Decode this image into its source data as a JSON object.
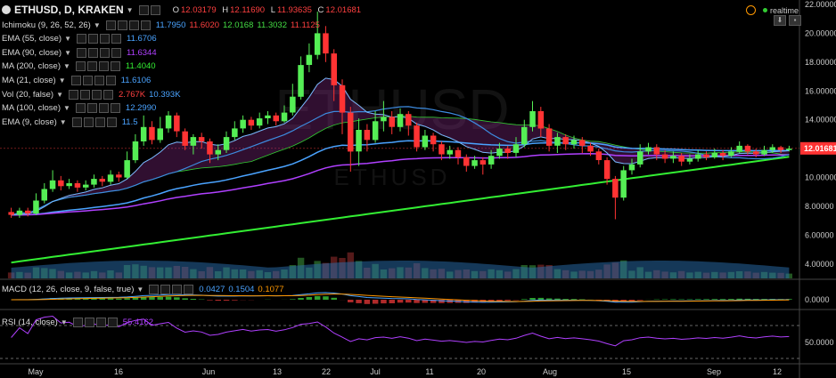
{
  "header": {
    "symbol_title": "ETHUSD, D, KRAKEN",
    "ohlc": [
      {
        "k": "O",
        "v": "12.03179"
      },
      {
        "k": "H",
        "v": "12.11690"
      },
      {
        "k": "L",
        "v": "11.93635"
      },
      {
        "k": "C",
        "v": "12.01681"
      }
    ],
    "realtime_label": "realtime"
  },
  "indicators": [
    {
      "name": "Ichimoku (9, 26, 52, 26)",
      "values": [
        {
          "text": "11.7950",
          "color": "#4aa3ff"
        },
        {
          "text": "11.6020",
          "color": "#ff4040"
        },
        {
          "text": "12.0168",
          "color": "#44dd44"
        },
        {
          "text": "11.3032",
          "color": "#44dd44"
        },
        {
          "text": "11.1125",
          "color": "#ff4040"
        }
      ]
    },
    {
      "name": "EMA (55, close)",
      "values": [
        {
          "text": "11.6706",
          "color": "#4aa3ff"
        }
      ]
    },
    {
      "name": "EMA (90, close)",
      "values": [
        {
          "text": "11.6344",
          "color": "#b040ff"
        }
      ]
    },
    {
      "name": "MA (200, close)",
      "values": [
        {
          "text": "11.4040",
          "color": "#33ee33"
        }
      ]
    },
    {
      "name": "MA (21, close)",
      "values": [
        {
          "text": "11.6106",
          "color": "#4aa3ff"
        }
      ]
    },
    {
      "name": "Vol (20, false)",
      "values": [
        {
          "text": "2.767K",
          "color": "#ff4040"
        },
        {
          "text": "10.393K",
          "color": "#4aa3ff"
        }
      ]
    },
    {
      "name": "MA (100, close)",
      "values": [
        {
          "text": "12.2990",
          "color": "#4aa3ff"
        }
      ]
    },
    {
      "name": "EMA (9, close)",
      "values": [
        {
          "text": "11.5",
          "color": "#4aa3ff"
        }
      ]
    }
  ],
  "watermark": {
    "big": "ETHUSD",
    "small": "ETHUSD"
  },
  "price_axis": {
    "ticks": [
      "22.00000",
      "20.00000",
      "18.00000",
      "16.00000",
      "14.00000",
      "12.00000",
      "10.00000",
      "8.00000",
      "6.00000",
      "4.00000"
    ],
    "last_price": "12.01681"
  },
  "macd": {
    "label": "MACD (12, 26, close, 9, false, true)",
    "values": [
      {
        "text": "0.0427",
        "color": "#4aa3ff"
      },
      {
        "text": "0.1504",
        "color": "#4aa3ff"
      },
      {
        "text": "0.1077",
        "color": "#ff9800"
      }
    ],
    "axis": [
      "0.0000"
    ]
  },
  "rsi": {
    "label": "RSI (14, close)",
    "value": {
      "text": "55.4162",
      "color": "#b040ff"
    },
    "axis": [
      "50.0000"
    ]
  },
  "time_axis": [
    "May",
    "16",
    "Jun",
    "13",
    "22",
    "Jul",
    "11",
    "20",
    "Aug",
    "15",
    "Sep",
    "12"
  ],
  "chart_data": {
    "type": "candlestick",
    "ylim": [
      3,
      22
    ],
    "y_ticks": [
      4,
      6,
      8,
      10,
      12,
      14,
      16,
      18,
      20,
      22
    ],
    "candles": [
      [
        7.6,
        7.4,
        7.9,
        7.2
      ],
      [
        7.4,
        7.7,
        7.9,
        7.2
      ],
      [
        7.7,
        7.5,
        7.9,
        7.3
      ],
      [
        7.5,
        8.4,
        8.9,
        7.4
      ],
      [
        8.4,
        9.2,
        9.6,
        8.2
      ],
      [
        9.2,
        9.8,
        10.5,
        9.0
      ],
      [
        9.8,
        9.4,
        10.1,
        9.1
      ],
      [
        9.4,
        9.6,
        9.9,
        9.2
      ],
      [
        9.6,
        9.3,
        9.8,
        9.0
      ],
      [
        9.3,
        9.5,
        9.8,
        9.1
      ],
      [
        9.5,
        9.9,
        10.2,
        9.3
      ],
      [
        9.9,
        9.7,
        10.1,
        9.4
      ],
      [
        9.7,
        10.2,
        10.5,
        9.5
      ],
      [
        10.2,
        10.0,
        10.4,
        9.7
      ],
      [
        10.0,
        11.2,
        11.8,
        9.9
      ],
      [
        11.2,
        12.5,
        13.0,
        11.0
      ],
      [
        12.5,
        13.5,
        14.3,
        12.2
      ],
      [
        13.5,
        12.6,
        13.9,
        12.3
      ],
      [
        12.6,
        13.4,
        14.2,
        12.4
      ],
      [
        13.4,
        14.3,
        14.6,
        13.1
      ],
      [
        14.3,
        13.2,
        14.5,
        12.8
      ],
      [
        13.2,
        12.2,
        13.4,
        11.9
      ],
      [
        12.2,
        12.8,
        13.0,
        11.6
      ],
      [
        12.8,
        12.5,
        13.1,
        12.0
      ],
      [
        12.5,
        11.6,
        12.7,
        11.0
      ],
      [
        11.6,
        11.9,
        12.3,
        11.2
      ],
      [
        11.9,
        12.8,
        13.2,
        11.7
      ],
      [
        12.8,
        13.4,
        13.9,
        12.6
      ],
      [
        13.4,
        14.0,
        14.3,
        13.1
      ],
      [
        14.0,
        13.6,
        14.2,
        13.3
      ],
      [
        13.6,
        14.1,
        14.5,
        13.4
      ],
      [
        14.1,
        14.3,
        14.6,
        13.7
      ],
      [
        14.3,
        13.9,
        14.5,
        13.6
      ],
      [
        13.9,
        14.5,
        15.0,
        13.8
      ],
      [
        14.5,
        15.6,
        16.5,
        14.3
      ],
      [
        15.6,
        17.8,
        18.4,
        15.4
      ],
      [
        17.8,
        18.5,
        19.3,
        17.3
      ],
      [
        18.5,
        20.0,
        21.5,
        18.2
      ],
      [
        20.0,
        18.6,
        20.5,
        18.0
      ],
      [
        18.6,
        16.4,
        18.9,
        15.3
      ],
      [
        16.4,
        14.5,
        16.8,
        13.0
      ],
      [
        14.5,
        11.8,
        14.9,
        10.4
      ],
      [
        11.8,
        13.3,
        14.1,
        10.8
      ],
      [
        13.3,
        12.6,
        13.7,
        11.8
      ],
      [
        12.6,
        13.9,
        14.6,
        12.4
      ],
      [
        13.9,
        14.2,
        15.3,
        13.2
      ],
      [
        14.2,
        13.5,
        14.6,
        13.0
      ],
      [
        13.5,
        14.4,
        14.8,
        13.2
      ],
      [
        14.4,
        13.6,
        14.6,
        12.9
      ],
      [
        13.6,
        12.1,
        13.8,
        11.8
      ],
      [
        12.1,
        12.9,
        13.3,
        11.9
      ],
      [
        12.9,
        12.3,
        13.1,
        11.8
      ],
      [
        12.3,
        11.6,
        12.5,
        11.2
      ],
      [
        11.6,
        11.9,
        12.2,
        11.3
      ],
      [
        11.9,
        11.4,
        12.1,
        10.9
      ],
      [
        11.4,
        10.8,
        11.6,
        10.4
      ],
      [
        10.8,
        11.2,
        11.5,
        10.6
      ],
      [
        11.2,
        10.9,
        11.4,
        10.2
      ],
      [
        10.9,
        11.5,
        11.9,
        10.6
      ],
      [
        11.5,
        12.0,
        12.4,
        11.3
      ],
      [
        12.0,
        11.7,
        12.2,
        11.3
      ],
      [
        11.7,
        12.3,
        12.8,
        11.4
      ],
      [
        12.3,
        13.5,
        14.0,
        12.1
      ],
      [
        13.5,
        14.6,
        15.3,
        13.2
      ],
      [
        14.6,
        13.4,
        14.9,
        12.8
      ],
      [
        13.4,
        12.2,
        13.7,
        11.8
      ],
      [
        12.2,
        12.8,
        13.1,
        11.7
      ],
      [
        12.8,
        12.3,
        13.0,
        11.9
      ],
      [
        12.3,
        12.6,
        12.9,
        12.0
      ],
      [
        12.6,
        12.2,
        12.8,
        11.7
      ],
      [
        12.2,
        11.8,
        12.4,
        11.5
      ],
      [
        11.8,
        11.2,
        12.0,
        10.9
      ],
      [
        11.2,
        9.9,
        11.4,
        9.5
      ],
      [
        9.9,
        8.6,
        10.1,
        7.1
      ],
      [
        8.6,
        10.5,
        10.8,
        8.4
      ],
      [
        10.5,
        10.9,
        11.3,
        10.2
      ],
      [
        10.9,
        11.8,
        12.3,
        10.7
      ],
      [
        11.8,
        12.1,
        12.4,
        11.6
      ],
      [
        12.1,
        11.6,
        12.3,
        11.2
      ],
      [
        11.6,
        11.3,
        11.9,
        11.0
      ],
      [
        11.3,
        11.5,
        11.8,
        11.0
      ],
      [
        11.5,
        11.1,
        11.7,
        10.8
      ],
      [
        11.1,
        11.3,
        11.6,
        10.9
      ],
      [
        11.3,
        11.6,
        11.9,
        11.1
      ],
      [
        11.6,
        11.4,
        11.8,
        11.2
      ],
      [
        11.4,
        11.7,
        12.0,
        11.3
      ],
      [
        11.7,
        11.5,
        11.9,
        11.2
      ],
      [
        11.5,
        11.8,
        12.1,
        11.4
      ],
      [
        11.8,
        12.2,
        12.5,
        11.7
      ],
      [
        12.2,
        11.8,
        12.3,
        11.6
      ],
      [
        11.8,
        11.6,
        12.0,
        11.4
      ],
      [
        11.6,
        11.9,
        12.2,
        11.5
      ],
      [
        11.9,
        12.1,
        12.3,
        11.7
      ],
      [
        12.1,
        11.9,
        12.2,
        11.7
      ],
      [
        11.9,
        12.0,
        12.2,
        11.8
      ]
    ]
  }
}
